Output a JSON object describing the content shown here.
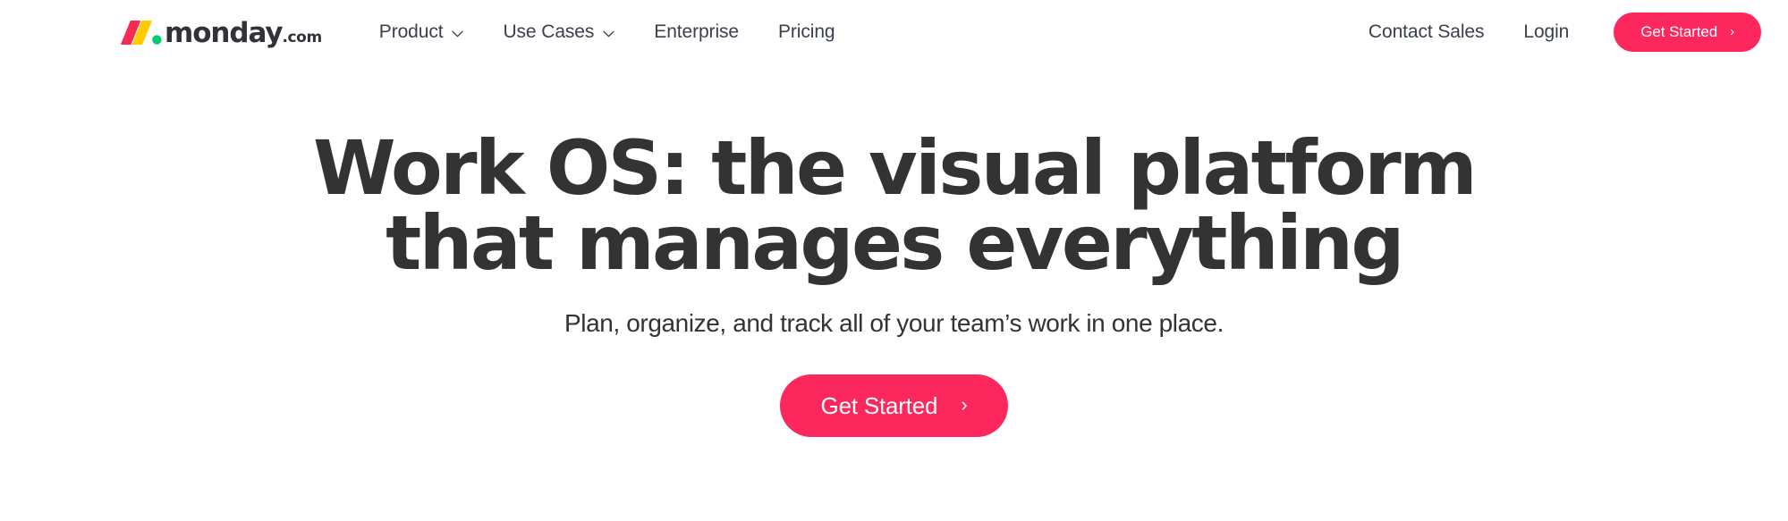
{
  "brand": {
    "accent_pink": "#fb275d",
    "logo_slash_pink": "#f62b54",
    "logo_slash_yellow": "#ffcb00",
    "logo_dot_green": "#00ca72",
    "text_dark": "#333333",
    "nav_text": "#3a3f4d",
    "background": "#ffffff"
  },
  "header": {
    "logo": {
      "name": "monday",
      "tld": ".com",
      "mark_icon": "monday-logo-mark"
    },
    "nav_items": [
      {
        "label": "Product",
        "has_dropdown": true,
        "icon": "chevron-down-icon"
      },
      {
        "label": "Use Cases",
        "has_dropdown": true,
        "icon": "chevron-down-icon"
      },
      {
        "label": "Enterprise",
        "has_dropdown": false,
        "icon": ""
      },
      {
        "label": "Pricing",
        "has_dropdown": false,
        "icon": ""
      }
    ],
    "contact_sales_label": "Contact Sales",
    "login_label": "Login",
    "cta": {
      "label": "Get Started",
      "arrow": "›",
      "arrow_icon": "chevron-right-icon"
    }
  },
  "hero": {
    "title_line1": "Work OS: the visual platform",
    "title_line2": "that manages everything",
    "subtitle": "Plan, organize, and track all of your team’s work in one place.",
    "cta": {
      "label": "Get Started",
      "arrow": "›",
      "arrow_icon": "chevron-right-icon"
    }
  }
}
